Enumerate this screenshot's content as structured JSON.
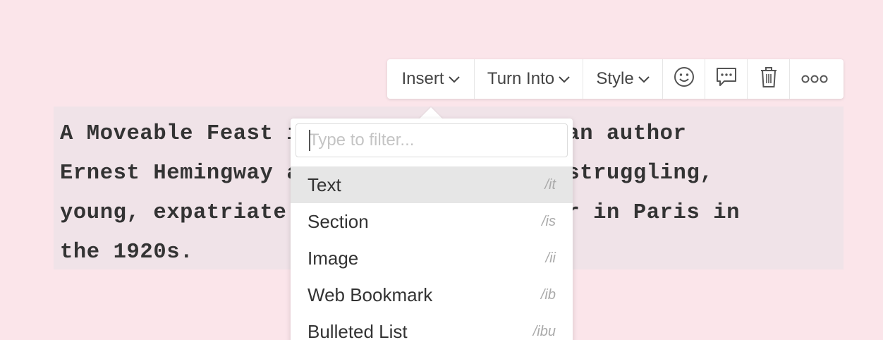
{
  "block": {
    "lines": [
      "A Moveable Feast is a memoir by American author",
      "Ernest Hemingway about his years as a struggling,",
      "young, expatriate journalist and writer in Paris in",
      "the 1920s."
    ]
  },
  "toolbar": {
    "insert_label": "Insert",
    "turn_into_label": "Turn Into",
    "style_label": "Style",
    "icons": [
      "emoji-icon",
      "comment-icon",
      "trash-icon",
      "more-icon"
    ]
  },
  "menu": {
    "filter_placeholder": "Type to filter...",
    "items": [
      {
        "label": "Text",
        "shortcut": "/it",
        "active": true
      },
      {
        "label": "Section",
        "shortcut": "/is"
      },
      {
        "label": "Image",
        "shortcut": "/ii"
      },
      {
        "label": "Web Bookmark",
        "shortcut": "/ib"
      },
      {
        "label": "Bulleted List",
        "shortcut": "/ibu"
      }
    ]
  },
  "colors": {
    "background": "#fbe5ea",
    "selection": "#f0e3e8",
    "active_item": "#e6e6e6"
  }
}
